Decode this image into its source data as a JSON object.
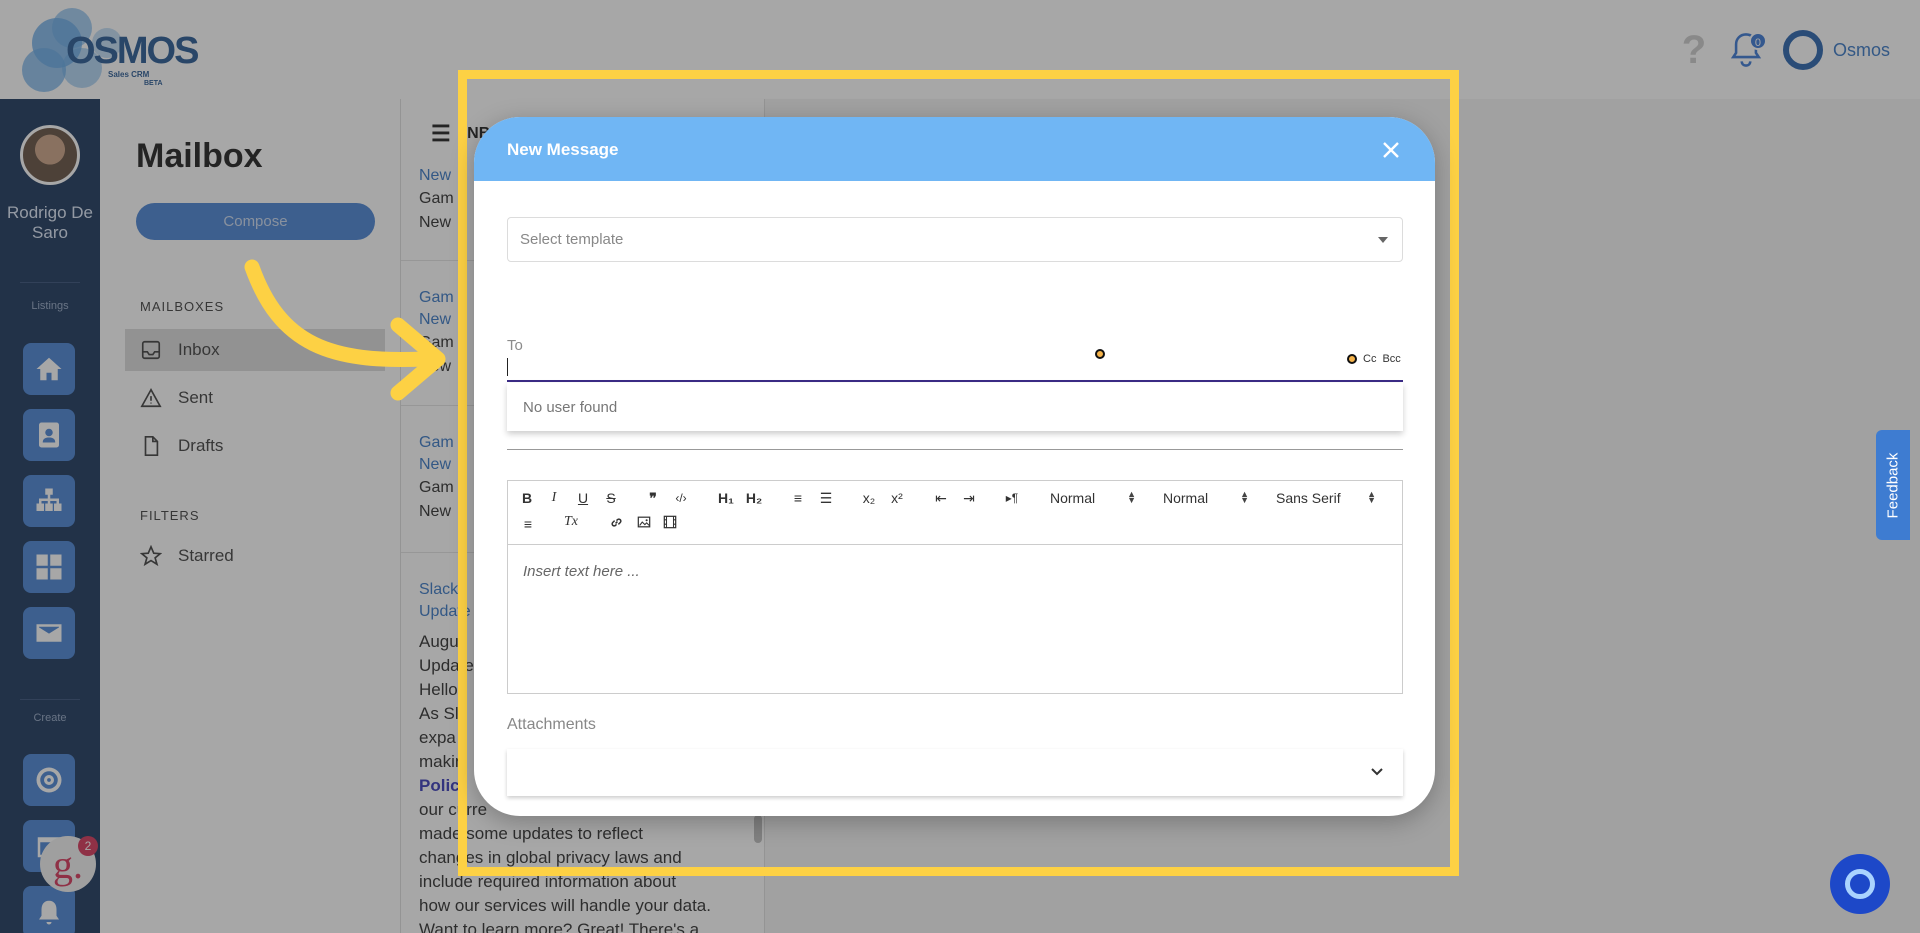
{
  "app": {
    "logo_word": "OSMOS",
    "logo_sub": "Sales CRM",
    "logo_beta": "BETA",
    "notification_count": "0",
    "user_menu_label": "Osmos"
  },
  "sidebar": {
    "user_name": "Rodrigo De Saro",
    "section_listings": "Listings",
    "section_create": "Create",
    "items": [
      {
        "icon": "home-icon"
      },
      {
        "icon": "contact-card-icon"
      },
      {
        "icon": "org-chart-icon"
      },
      {
        "icon": "dashboard-grid-icon"
      },
      {
        "icon": "mail-icon"
      },
      {
        "icon": "target-icon"
      },
      {
        "icon": "calendar-icon"
      },
      {
        "icon": "bell-icon"
      }
    ],
    "g_badge_letter": "g.",
    "g_badge_count": "2"
  },
  "mailnav": {
    "title": "Mailbox",
    "compose_label": "Compose",
    "mailboxes_label": "MAILBOXES",
    "filters_label": "FILTERS",
    "items": [
      {
        "label": "Inbox",
        "icon": "inbox-icon"
      },
      {
        "label": "Sent",
        "icon": "sent-icon"
      },
      {
        "label": "Drafts",
        "icon": "drafts-icon"
      }
    ],
    "filters": [
      {
        "label": "Starred",
        "icon": "star-icon"
      }
    ]
  },
  "maillist": {
    "header": "INBOX",
    "items": [
      {
        "subject": "New",
        "lines": [
          "Gam",
          "New"
        ]
      },
      {
        "subject": "Gam",
        "subject2": "New",
        "lines": [
          "Gam",
          "New"
        ]
      },
      {
        "subject": "Gam",
        "subject2": "New",
        "lines": [
          "Gam",
          "New"
        ]
      },
      {
        "subject": "Slack",
        "subject2": "Update"
      }
    ],
    "body_lines": [
      "Augus",
      "Update",
      "Hello",
      "As Sl",
      "expa",
      "makin",
      "Polic",
      "our curre",
      "made some updates to reflect",
      "changes in global privacy laws and",
      "include required information about",
      "how our services will handle your data.",
      "Want to learn more? Great! There's a"
    ]
  },
  "feedback_label": "Feedback",
  "dialog": {
    "title": "New Message",
    "template_placeholder": "Select template",
    "to_label": "To",
    "cc_label": "Cc",
    "bcc_label": "Bcc",
    "no_user_text": "No user found",
    "toolbar": {
      "bold": "B",
      "italic": "I",
      "underline": "U",
      "strike": "S",
      "quote": "❞",
      "code": "‹/›",
      "h1": "H₁",
      "h2": "H₂",
      "ordered": "≡",
      "bullet": "☰",
      "sub": "x₂",
      "sup": "x²",
      "outdent": "⇤",
      "indent": "⇥",
      "rtl": "▸¶",
      "size1": "Normal",
      "size2": "Normal",
      "font": "Sans Serif",
      "align": "≡",
      "clean": "Tx"
    },
    "editor_placeholder": "Insert text here ...",
    "attachments_label": "Attachments"
  },
  "colors": {
    "dialog_header": "#70b6f4",
    "highlight": "#fdd144",
    "arrow": "#fdd144",
    "sidebar_bg": "#0d2a52",
    "accent": "#3e7cd1"
  }
}
